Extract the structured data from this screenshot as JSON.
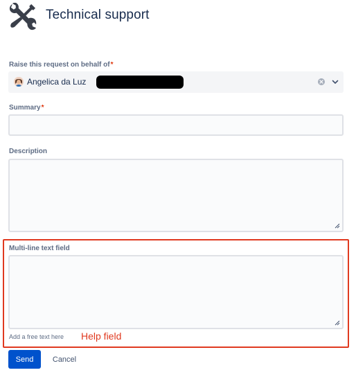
{
  "header": {
    "icon": "tools-icon",
    "title": "Technical support"
  },
  "form": {
    "on_behalf": {
      "label": "Raise this request on behalf of",
      "required_mark": "*",
      "value": "Angelica da Luz",
      "icons": [
        "avatar",
        "clear-icon",
        "chevron-down-icon"
      ]
    },
    "summary": {
      "label": "Summary",
      "required_mark": "*",
      "value": ""
    },
    "description": {
      "label": "Description",
      "value": ""
    },
    "multiline": {
      "label": "Multi-line text field",
      "value": "",
      "help_text": "Add a free text here"
    }
  },
  "annotation": {
    "label": "Help field",
    "color": "#e0391f"
  },
  "actions": {
    "send_label": "Send",
    "cancel_label": "Cancel"
  },
  "colors": {
    "primary": "#0052cc",
    "required": "#de350b",
    "label": "#5e6c84",
    "text": "#172b4d"
  }
}
